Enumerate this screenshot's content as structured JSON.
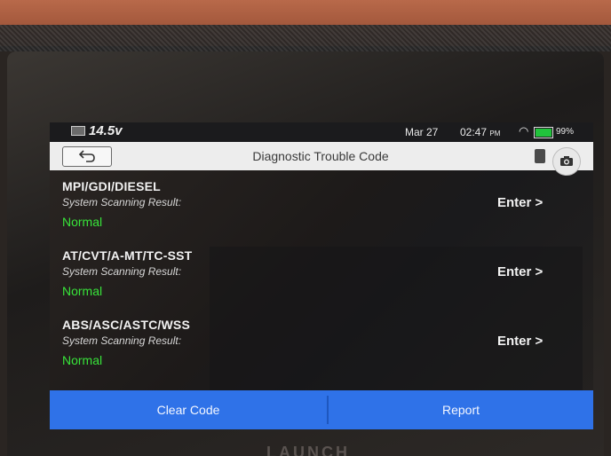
{
  "device": {
    "brand": "LAUNCH"
  },
  "status": {
    "voltage": "14.5v",
    "date": "Mar 27",
    "time": "02:47",
    "ampm": "PM",
    "battery_pct": "99%",
    "battery_level": 0.99,
    "colors": {
      "battery_fill": "#22c33c"
    },
    "icons": [
      "vehicle-battery-icon",
      "wifi-icon",
      "battery-icon"
    ]
  },
  "titlebar": {
    "title": "Diagnostic Trouble Code",
    "icons": [
      "back-arrow-icon",
      "sd-card-icon",
      "camera-icon"
    ]
  },
  "systems": [
    {
      "name": "MPI/GDI/DIESEL",
      "result_label": "System Scanning Result:",
      "result": "Normal",
      "action": "Enter >"
    },
    {
      "name": "AT/CVT/A-MT/TC-SST",
      "result_label": "System Scanning Result:",
      "result": "Normal",
      "action": "Enter >"
    },
    {
      "name": "ABS/ASC/ASTC/WSS",
      "result_label": "System Scanning Result:",
      "result": "Normal",
      "action": "Enter >"
    }
  ],
  "footer": {
    "clear_label": "Clear Code",
    "report_label": "Report",
    "colors": {
      "bar": "#2f72e8",
      "normal_text": "#38e43a"
    }
  }
}
